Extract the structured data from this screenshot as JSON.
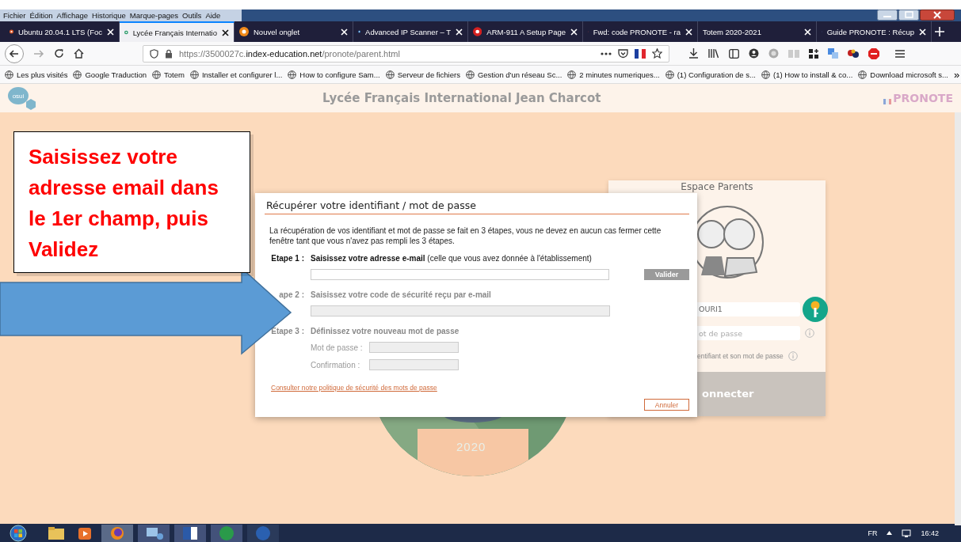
{
  "menu_bar": [
    "Fichier",
    "Édition",
    "Affichage",
    "Historique",
    "Marque-pages",
    "Outils",
    "Aide"
  ],
  "tabs": [
    {
      "title": "Ubuntu 20.04.1 LTS (Foc",
      "selected": false
    },
    {
      "title": "Lycée Français Internatio",
      "selected": true
    },
    {
      "title": "Nouvel onglet",
      "selected": false
    },
    {
      "title": "Advanced IP Scanner – T",
      "selected": false
    },
    {
      "title": "ARM-911 A Setup Page",
      "selected": false
    },
    {
      "title": "Fwd: code PRONOTE - ra",
      "selected": false
    },
    {
      "title": "Totem 2020-2021",
      "selected": false
    },
    {
      "title": "Guide PRONOTE : Récup",
      "selected": false
    }
  ],
  "address_bar": {
    "prefix": "https://3500027c.",
    "domain": "index-education.net",
    "path": "/pronote/parent.html"
  },
  "bookmarks": [
    "Les plus visités",
    "Google Traduction",
    "Totem",
    "Installer et configurer l...",
    "How to configure Sam...",
    "Serveur de fichiers",
    "Gestion d'un réseau Sc...",
    "2 minutes numeriques...",
    "(1) Configuration de s...",
    "(1) How to install & co...",
    "Download microsoft s..."
  ],
  "bookmarks_overflow": "»",
  "page": {
    "logo": "osui",
    "school": "Lycée Français International Jean Charcot",
    "brand": "PRONOTE",
    "picture_caption": "2020"
  },
  "login_card": {
    "title": "Espace Parents",
    "username": "OURI1",
    "password_placeholder": "ot de passe",
    "help": "entifiant et son mot de passe",
    "connect": "onnecter"
  },
  "callout": {
    "text": "Saisissez votre adresse email dans le 1er champ, puis Validez"
  },
  "dialog": {
    "title": "Récupérer votre identifiant / mot de passe",
    "intro": "La récupération de vos identifiant et mot de passe se fait en 3 étapes, vous ne devez en aucun cas fermer cette fenêtre tant que vous n'avez pas rempli les 3 étapes.",
    "steps": [
      {
        "label": "Etape 1 :",
        "text": "**Saisissez votre adresse e-mail** (celle que vous avez donnée à l'établissement)",
        "disabled": false
      },
      {
        "label": "ape 2 :",
        "text": "Saisissez votre code de sécurité reçu par e-mail",
        "disabled": true
      },
      {
        "label": "Etape 3 :",
        "text": "Définissez votre nouveau mot de passe",
        "disabled": true,
        "fields": [
          "Mot de passe :",
          "Confirmation :"
        ]
      }
    ],
    "validate_button": {
      "label": "Valider",
      "disabled": true
    },
    "policy_link": "Consulter notre politique de sécurité des mots de passe",
    "cancel_button": "Annuler"
  },
  "taskbar": {
    "language": "FR",
    "time": "16:42"
  }
}
